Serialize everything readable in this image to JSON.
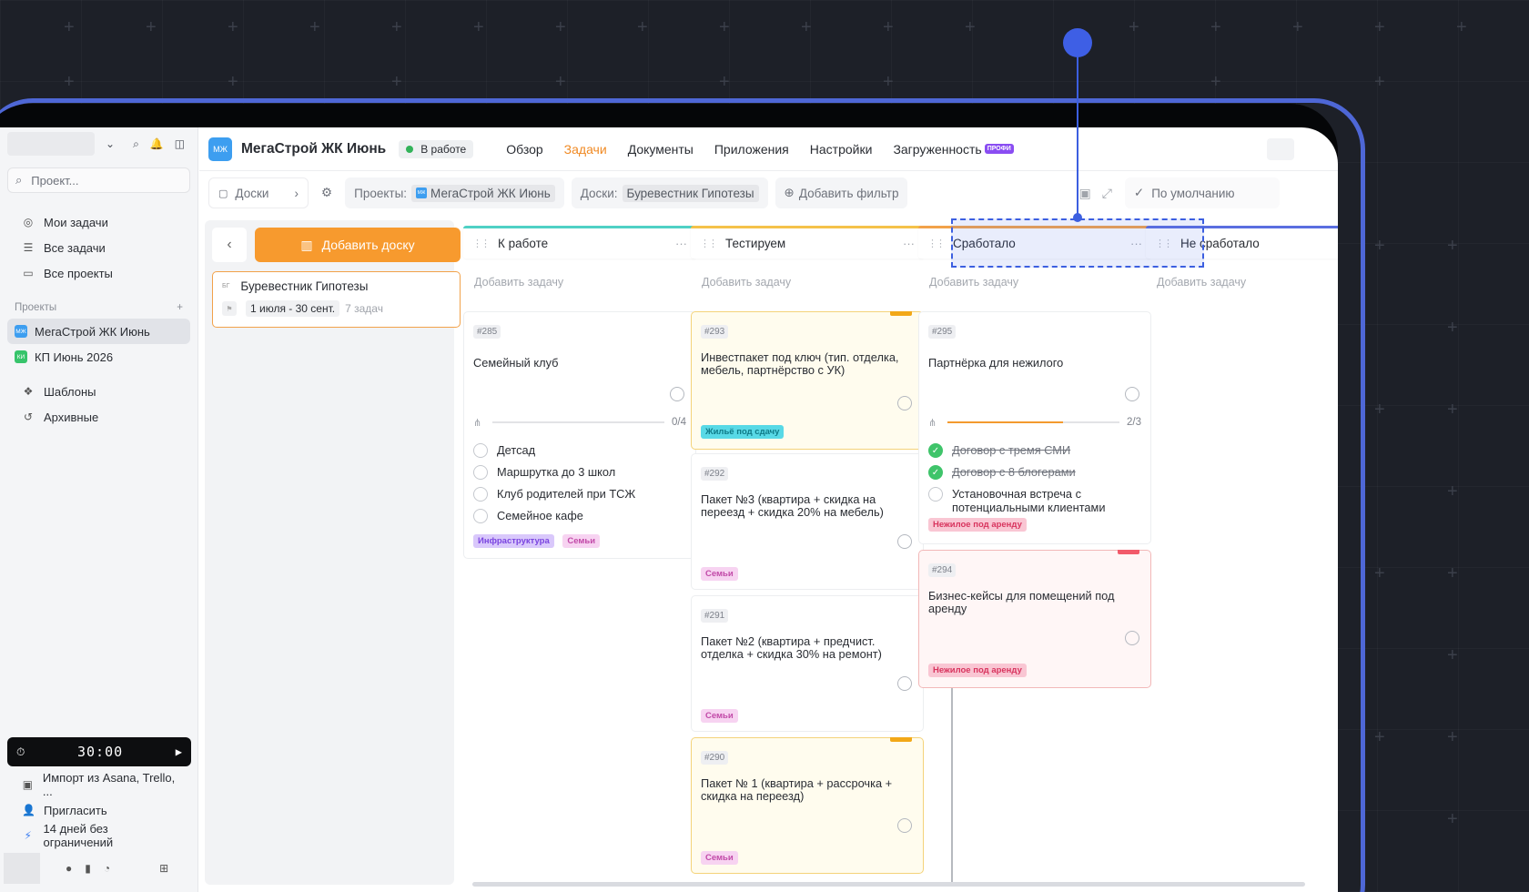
{
  "sidebar": {
    "search_placeholder": "Проект...",
    "nav": [
      {
        "label": "Мои задачи",
        "icon": "target-icon"
      },
      {
        "label": "Все задачи",
        "icon": "list-icon"
      },
      {
        "label": "Все проекты",
        "icon": "folder-icon"
      }
    ],
    "projects_label": "Проекты",
    "projects": [
      {
        "badge": "МЖ",
        "label": "МегаСтрой ЖК Июнь",
        "color": "#3d9ef0"
      },
      {
        "badge": "КИ",
        "label": "КП Июнь 2026",
        "color": "#37c46b"
      }
    ],
    "extra": [
      {
        "label": "Шаблоны",
        "icon": "templates-icon"
      },
      {
        "label": "Архивные",
        "icon": "history-icon"
      }
    ],
    "timer": "30:00",
    "bottom": [
      {
        "label": "Импорт из Asana, Trello, ...",
        "icon": "trello-icon"
      },
      {
        "label": "Пригласить",
        "icon": "invite-icon"
      },
      {
        "label": "14 дней без ограничений",
        "icon": "bolt-icon"
      }
    ]
  },
  "header": {
    "badge": "МЖ",
    "title": "МегаСтрой ЖК Июнь",
    "status": "В работе",
    "tabs": [
      "Обзор",
      "Задачи",
      "Документы",
      "Приложения",
      "Настройки",
      "Загруженность"
    ],
    "active_tab": "Задачи",
    "pro_tag": "ПРОФИ"
  },
  "filters": {
    "boards_label": "Доски",
    "projects_label": "Проекты:",
    "projects_value": "МегаСтрой ЖК Июнь",
    "project_badge": "МЖ",
    "boards_filter_label": "Доски:",
    "boards_value": "Буревестник Гипотезы",
    "add_filter": "Добавить фильтр",
    "default_view": "По умолчанию"
  },
  "boards_panel": {
    "add_board": "Добавить доску",
    "board": {
      "badge": "БГ",
      "title": "Буревестник Гипотезы",
      "dates": "1 июля - 30 сент.",
      "count": "7 задач"
    }
  },
  "columns": [
    {
      "title": "К работе",
      "color": "#4fd1c5",
      "add": "Добавить задачу"
    },
    {
      "title": "Тестируем",
      "color": "#f5c24a",
      "add": "Добавить задачу"
    },
    {
      "title": "Сработало",
      "color": "#f2a24a",
      "add": "Добавить задачу"
    },
    {
      "title": "Не сработало",
      "color": "#5a6ee0",
      "add": "Добавить задачу"
    }
  ],
  "cards": {
    "c285": {
      "num": "#285",
      "title": "Семейный клуб",
      "progress": "0/4",
      "items": [
        "Детсад",
        "Маршрутка до 3 школ",
        "Клуб родителей при ТСЖ",
        "Семейное кафе"
      ],
      "tags": [
        "Инфраструктура",
        "Семьи"
      ]
    },
    "c293": {
      "num": "#293",
      "title": "Инвестпакет под ключ (тип. отделка, мебель, партнёрство с УК)",
      "tag": "Жильё под сдачу"
    },
    "c292": {
      "num": "#292",
      "title": "Пакет №3 (квартира + скидка на переезд + скидка 20% на мебель)",
      "tag": "Семьи"
    },
    "c291": {
      "num": "#291",
      "title": "Пакет №2 (квартира + предчист. отделка + скидка 30% на ремонт)",
      "tag": "Семьи"
    },
    "c290": {
      "num": "#290",
      "title": "Пакет № 1 (квартира + рассрочка + скидка на переезд)",
      "tag": "Семьи"
    },
    "c295": {
      "num": "#295",
      "title": "Партнёрка для нежилого",
      "progress": "2/3",
      "progress_fraction": 0.67,
      "items": [
        "Договор с тремя СМИ",
        "Договор с 8 блогерами",
        "Установочная встреча с потенциальными клиентами"
      ],
      "tag": "Нежилое под аренду"
    },
    "c294": {
      "num": "#294",
      "title": "Бизнес-кейсы для помещений под аренду",
      "tag": "Нежилое под аренду"
    }
  }
}
